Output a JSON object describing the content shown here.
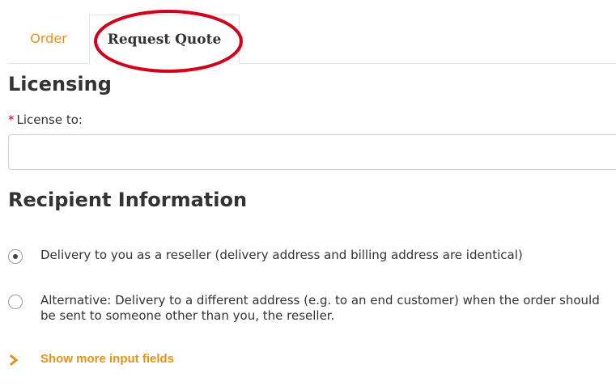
{
  "tabs": [
    {
      "label": "Order",
      "active": false
    },
    {
      "label": "Request Quote",
      "active": true
    }
  ],
  "licensing": {
    "heading": "Licensing",
    "required_marker": "*",
    "license_label": "License to:",
    "license_value": ""
  },
  "recipient": {
    "heading": "Recipient Information",
    "options": [
      {
        "label": "Delivery to you as a reseller (delivery address and billing address are identical)",
        "checked": true
      },
      {
        "label": "Alternative: Delivery to a different address (e.g. to an end customer) when the order should be sent to someone other than you, the reseller.",
        "checked": false
      }
    ]
  },
  "show_more": {
    "label": "Show more input fields",
    "icon": "chevron-right-icon"
  },
  "colors": {
    "accent": "#e29419",
    "annotation": "#d0021b",
    "required": "#d0021b"
  }
}
